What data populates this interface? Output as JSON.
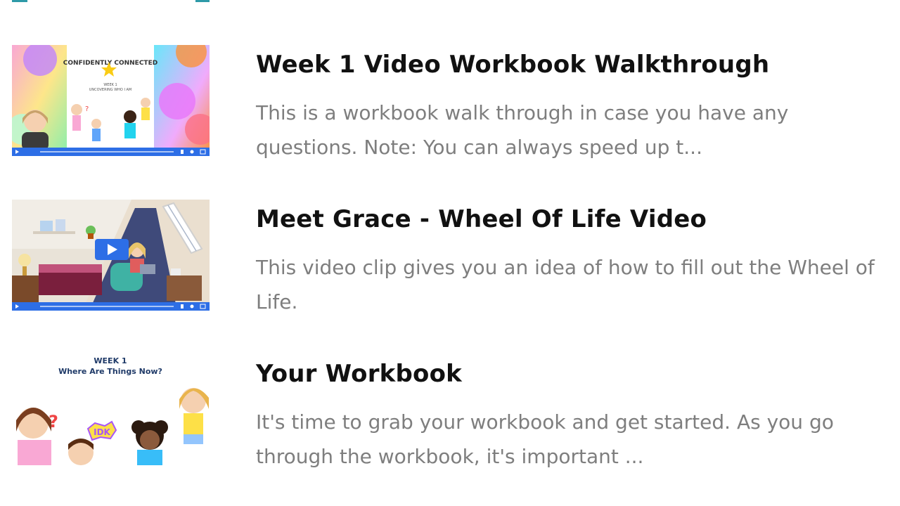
{
  "colors": {
    "title": "#111111",
    "description": "#7e7e7e",
    "accent": "#2e9aa8",
    "player_bar": "#2d6ee6"
  },
  "lessons": [
    {
      "title": "Week 1 Video Workbook Walkthrough",
      "description": "This is a workbook walk through in case you have any questions.  Note:  You can always speed up t...",
      "thumbnail": {
        "arc_text": "CONFIDENTLY CONNECTED",
        "line1": "WEEK 1",
        "line2": "UNCOVERING WHO I AM",
        "icon": "video-thumbnail"
      }
    },
    {
      "title": "Meet Grace - Wheel Of Life Video",
      "description": "This video clip gives you an idea of how to fill out the Wheel of Life.",
      "thumbnail": {
        "icon": "video-thumbnail"
      }
    },
    {
      "title": "Your Workbook",
      "description": "It's time to grab your workbook and get started.  As you go through the workbook, it's important ...",
      "thumbnail": {
        "line1": "WEEK 1",
        "line2": "Where Are Things Now?",
        "badge": "IDK",
        "icon": "image-thumbnail"
      }
    }
  ]
}
